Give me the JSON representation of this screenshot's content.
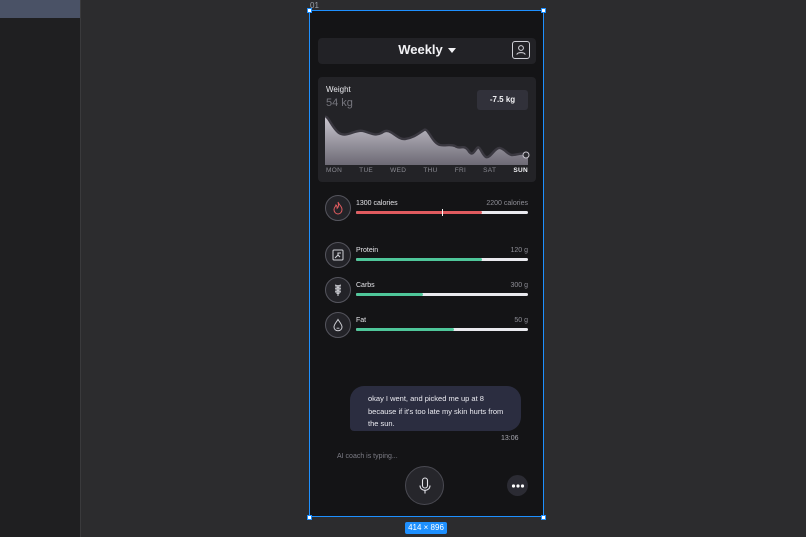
{
  "frame": {
    "name": "01",
    "size_label": "414 × 896"
  },
  "header": {
    "period": "Weekly"
  },
  "weight": {
    "label": "Weight",
    "value": "54 kg",
    "change": "-7.5 kg",
    "days": [
      "MON",
      "TUE",
      "WED",
      "THU",
      "FRI",
      "SAT",
      "SUN"
    ],
    "active_day": "SUN"
  },
  "calories": {
    "current": "1300 calories",
    "goal": "2200 calories",
    "progress": 0.73,
    "color": "#e05b5f"
  },
  "macros": [
    {
      "name": "Protein",
      "goal": "120 g",
      "progress": 0.73,
      "icon": "protein-icon",
      "color": "#4fc79a"
    },
    {
      "name": "Carbs",
      "goal": "300 g",
      "progress": 0.39,
      "icon": "wheat-icon",
      "color": "#4fc79a"
    },
    {
      "name": "Fat",
      "goal": "50 g",
      "progress": 0.57,
      "icon": "drop-icon",
      "color": "#4fc79a"
    }
  ],
  "chat": {
    "message": "okay I went, and picked me up at 8 because if it's too late my skin hurts from the sun.",
    "time": "13:06",
    "typing": "AI coach is typing..."
  },
  "colors": {
    "selection": "#1e90ff",
    "accent_green": "#4fc79a",
    "accent_red": "#e05b5f"
  }
}
